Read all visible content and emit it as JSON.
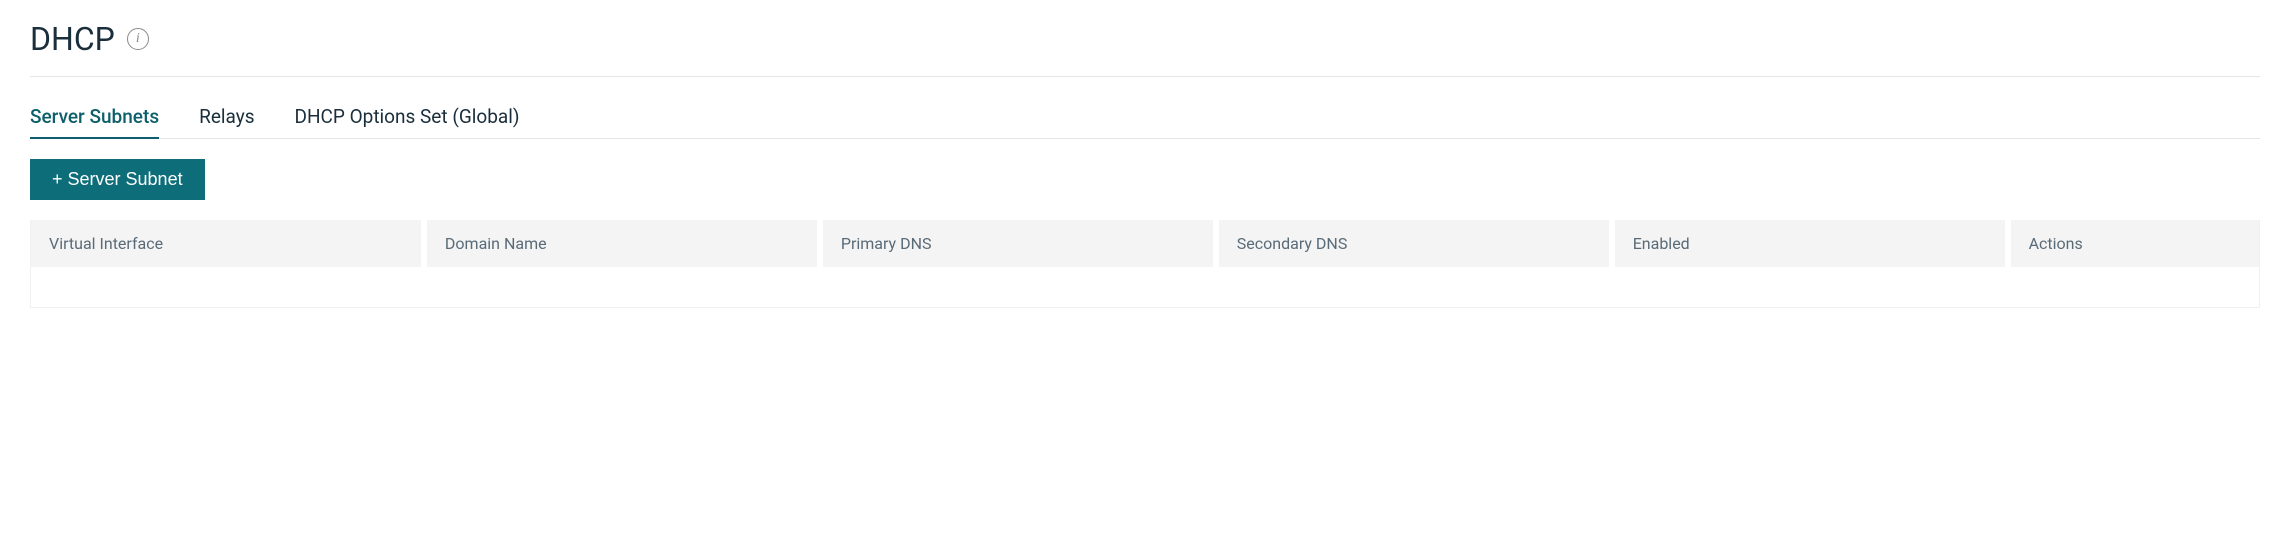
{
  "header": {
    "title": "DHCP"
  },
  "tabs": [
    {
      "label": "Server Subnets",
      "active": true
    },
    {
      "label": "Relays",
      "active": false
    },
    {
      "label": "DHCP Options Set (Global)",
      "active": false
    }
  ],
  "toolbar": {
    "add_button_label": "+ Server Subnet"
  },
  "table": {
    "columns": [
      "Virtual Interface",
      "Domain Name",
      "Primary DNS",
      "Secondary DNS",
      "Enabled",
      "Actions"
    ],
    "rows": []
  }
}
